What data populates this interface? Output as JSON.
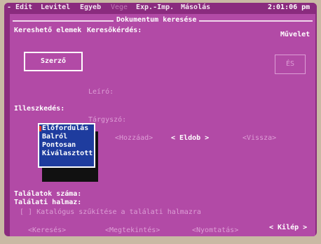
{
  "menubar": {
    "items": [
      "- Edit",
      "Levitel",
      "Egyeb",
      "Vege",
      "Exp.-Imp.",
      "Másolás"
    ],
    "clock": "2:01:06 pm"
  },
  "window": {
    "title": "Dokumentum keresése"
  },
  "header": {
    "col_left": "Kereshető elemek",
    "col_mid": "Keresőkérdés:",
    "col_right": "Művelet"
  },
  "fields": {
    "szerzo": "Szerző",
    "leiro": "Leíró:",
    "illeszkedes": "Illeszkedés:",
    "targyszo": "Tárgyszó:",
    "es": "ÉS"
  },
  "dropdown": {
    "options": [
      "Előfordulás",
      "Balról",
      "Pontosan",
      "Kiválasztott"
    ],
    "selected_index": 0
  },
  "actions": {
    "hozzaad": "<Hozzáad>",
    "eldob": "< Eldob >",
    "vissza": "<Vissza>"
  },
  "results": {
    "count_label": "Találatok száma:",
    "set_label": "Találati halmaz:",
    "filter_hint": "[ ] Katalógus szűkítése a találati halmazra"
  },
  "footer": {
    "kereses": "<Keresés>",
    "megtekintes": "<Megtekintés>",
    "nyomtatas": "<Nyomtatás>",
    "kilep": "< Kilép >"
  },
  "colors": {
    "screen_bg": "#b24aa6",
    "dropdown_bg": "#1e3c9e",
    "text": "#ffffff",
    "dim_text": "#dd9ed6"
  }
}
